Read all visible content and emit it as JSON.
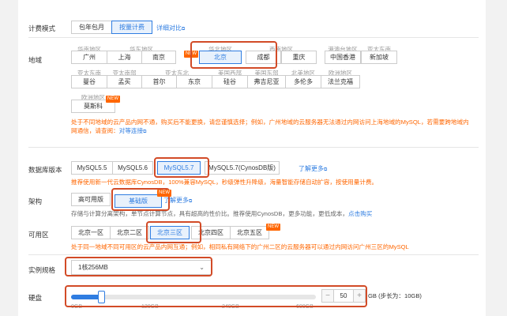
{
  "billing": {
    "label": "计费模式",
    "options": [
      "包年包月",
      "按量计费"
    ],
    "selected": 1,
    "compare_link": "详细对比"
  },
  "region": {
    "label": "地域",
    "groups": [
      {
        "caption": "华南地区",
        "items": [
          "广州"
        ]
      },
      {
        "caption": "华东地区",
        "items": [
          "上海",
          "南京"
        ]
      },
      {
        "caption": "华北地区",
        "items": [
          "北京"
        ]
      },
      {
        "caption": "西南地区",
        "items": [
          "成都",
          "重庆"
        ]
      },
      {
        "caption": "港澳台地区",
        "items": [
          "中国香港"
        ]
      },
      {
        "caption": "亚太东南",
        "items": [
          "新加坡"
        ]
      },
      {
        "caption": "亚太东南",
        "items": [
          "曼谷"
        ]
      },
      {
        "caption": "亚太南部",
        "items": [
          "孟买"
        ]
      },
      {
        "caption": "亚太东北",
        "items": [
          "首尔",
          "东京"
        ]
      },
      {
        "caption": "美国西部",
        "items": [
          "硅谷"
        ]
      },
      {
        "caption": "美国东部",
        "items": [
          "弗吉尼亚"
        ]
      },
      {
        "caption": "北美地区",
        "items": [
          "多伦多"
        ]
      },
      {
        "caption": "欧洲地区",
        "items": [
          "法兰克福"
        ]
      },
      {
        "caption": "欧洲地区",
        "items": [
          "莫斯科"
        ]
      }
    ],
    "selected": "北京",
    "new_badge": "NEW",
    "tip": "处于不同地域的云产品内网不通，购买后不能更换，请您谨慎选择；例如，广州地域的云服务器无法通过内网访问上海地域的MySQL，若需要跨地域内网通信，请查阅：",
    "tip_link": "对等连接"
  },
  "db_version": {
    "label": "数据库版本",
    "options": [
      "MySQL5.5",
      "MySQL5.6",
      "MySQL5.7",
      "MySQL5.7(CynosDB版)"
    ],
    "selected": 2,
    "learn_more": "了解更多",
    "tip": "推荐使用新一代云数据库CynosDB，100%兼容MySQL，秒级弹性升降级，海量智能存储自动扩容，按使用量计费。"
  },
  "architecture": {
    "label": "架构",
    "options": [
      "高可用版",
      "基础版"
    ],
    "selected": 1,
    "learn_more": "了解更多",
    "tip": "存储与计算分离架构，单节点计算节点，具有超高的性价比。推荐使用CynosDB，",
    "tip_more": "更多功能，更低成本，",
    "tip_link": "点击购买"
  },
  "zone": {
    "label": "可用区",
    "options": [
      "北京一区",
      "北京二区",
      "北京三区",
      "北京四区",
      "北京五区"
    ],
    "selected": 2,
    "tip": "处于同一地域不同可用区的云产品内网互通；例如，相同私有网络下的广州二区的云服务器可以通过内网访问广州三区的MySQL"
  },
  "instance_spec": {
    "label": "实例规格",
    "value": "1核256MB"
  },
  "disk": {
    "label": "硬盘",
    "value": "50",
    "unit_hint": "GB (步长为：10GB)",
    "ticks": [
      "0GB",
      "120GB",
      "240GB",
      "600GB"
    ],
    "fill_fraction": 0.06
  }
}
